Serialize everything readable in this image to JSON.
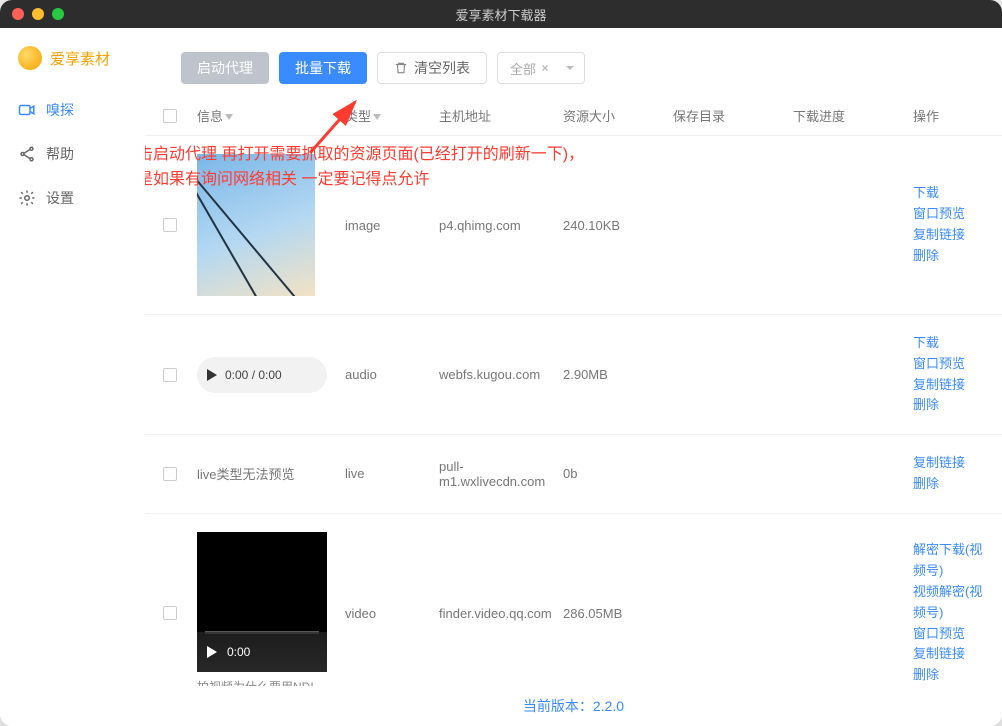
{
  "window": {
    "title": "爱享素材下载器"
  },
  "app": {
    "name": "爱享素材"
  },
  "sidebar": {
    "items": [
      {
        "key": "detect",
        "label": "嗅探"
      },
      {
        "key": "help",
        "label": "帮助"
      },
      {
        "key": "settings",
        "label": "设置"
      }
    ]
  },
  "toolbar": {
    "start_proxy": "启动代理",
    "batch_download": "批量下载",
    "clear_list": "清空列表",
    "filter_selected": "全部"
  },
  "annotation": {
    "line1": "先点击启动代理 再打开需要抓取的资源页面(已经打开的刷新一下)，",
    "line2": "安装是如果有询问网络相关 一定要记得点允许"
  },
  "columns": {
    "info": "信息",
    "type": "类型",
    "host": "主机地址",
    "size": "资源大小",
    "save_dir": "保存目录",
    "progress": "下载进度",
    "ops": "操作"
  },
  "ops": {
    "download": "下载",
    "window_preview": "窗口预览",
    "copy_link": "复制链接",
    "delete": "删除",
    "decrypt_download_wechat": "解密下载(视频号)",
    "video_decrypt_wechat": "视频解密(视频号)"
  },
  "audio": {
    "time": "0:00 / 0:00"
  },
  "video": {
    "time": "0:00",
    "caption": "拍视频为什么要用NDI"
  },
  "live_no_preview": "live类型无法预览",
  "rows": [
    {
      "type": "image",
      "host": "p4.qhimg.com",
      "size": "240.10KB",
      "ops": [
        "download",
        "window_preview",
        "copy_link",
        "delete"
      ]
    },
    {
      "type": "audio",
      "host": "webfs.kugou.com",
      "size": "2.90MB",
      "ops": [
        "download",
        "window_preview",
        "copy_link",
        "delete"
      ]
    },
    {
      "type": "live",
      "host": "pull-m1.wxlivecdn.com",
      "size": "0b",
      "ops": [
        "copy_link",
        "delete"
      ]
    },
    {
      "type": "video",
      "host": "finder.video.qq.com",
      "size": "286.05MB",
      "ops": [
        "decrypt_download_wechat",
        "video_decrypt_wechat",
        "window_preview",
        "copy_link",
        "delete"
      ]
    }
  ],
  "footer": {
    "version_label": "当前版本：2.2.0"
  }
}
